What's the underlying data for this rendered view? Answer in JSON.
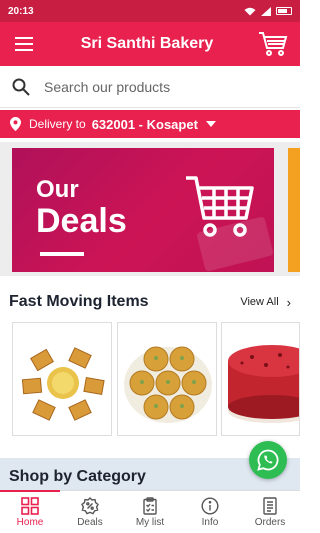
{
  "status_bar": {
    "time": "20:13"
  },
  "app_bar": {
    "title": "Sri Santhi Bakery",
    "menu_icon": "hamburger-menu-icon",
    "cart_icon": "shopping-cart-icon"
  },
  "search": {
    "placeholder": "Search our products",
    "value": ""
  },
  "delivery": {
    "label": "Delivery to",
    "location": "632001 - Kosapet"
  },
  "banner": {
    "line1": "Our",
    "line2": "Deals"
  },
  "fast_moving": {
    "title": "Fast Moving Items",
    "view_all": "View All",
    "products": [
      {
        "name": "mysore-pak-sweet"
      },
      {
        "name": "laddu-peda-sweet"
      },
      {
        "name": "red-velvet-cake"
      }
    ]
  },
  "category": {
    "title": "Shop by Category"
  },
  "bottom_nav": {
    "items": [
      {
        "label": "Home",
        "icon": "grid-icon",
        "active": true
      },
      {
        "label": "Deals",
        "icon": "badge-icon",
        "active": false
      },
      {
        "label": "My list",
        "icon": "clipboard-icon",
        "active": false
      },
      {
        "label": "Info",
        "icon": "info-icon",
        "active": false
      },
      {
        "label": "Orders",
        "icon": "orders-icon",
        "active": false
      }
    ]
  },
  "colors": {
    "primary": "#e8214e",
    "status_bar": "#c81e42",
    "whatsapp": "#2dbd52",
    "category_bg": "#dfe7f1"
  }
}
